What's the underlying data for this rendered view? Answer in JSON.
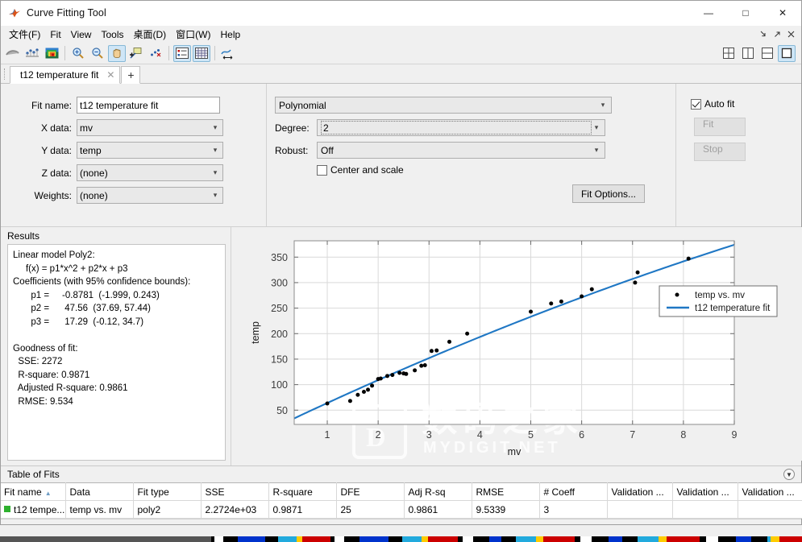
{
  "window": {
    "title": "Curve Fitting Tool",
    "minimize": "—",
    "maximize": "□",
    "close": "✕"
  },
  "menu": {
    "items": [
      {
        "label": "文件(F)",
        "name": "menu-file"
      },
      {
        "label": "Fit",
        "name": "menu-fit"
      },
      {
        "label": "View",
        "name": "menu-view"
      },
      {
        "label": "Tools",
        "name": "menu-tools"
      },
      {
        "label": "桌面(D)",
        "name": "menu-desktop"
      },
      {
        "label": "窗口(W)",
        "name": "menu-window"
      },
      {
        "label": "Help",
        "name": "menu-help"
      }
    ],
    "right_icons": [
      "dock-icon",
      "undock-icon",
      "close-icon"
    ]
  },
  "toolbar": {
    "buttons": [
      "fit-curve-icon",
      "data-points-icon",
      "surface-plot-icon",
      "zoom-in-icon",
      "zoom-out-icon",
      "pan-icon",
      "data-cursor-icon",
      "exclude-outliers-icon",
      "legend-icon",
      "grid-icon",
      "axes-limits-icon"
    ],
    "layout_buttons": [
      "layout-quad-icon",
      "layout-vertical-icon",
      "layout-horizontal-icon",
      "layout-single-icon"
    ]
  },
  "tabs": {
    "active": "t12 temperature fit",
    "close_glyph": "✕",
    "add_glyph": "+"
  },
  "fit_setup": {
    "fit_name_label": "Fit name:",
    "fit_name_value": "t12 temperature fit",
    "fields": [
      {
        "label": "X data:",
        "value": "mv",
        "name": "x-data-select"
      },
      {
        "label": "Y data:",
        "value": "temp",
        "name": "y-data-select"
      },
      {
        "label": "Z data:",
        "value": "(none)",
        "name": "z-data-select"
      },
      {
        "label": "Weights:",
        "value": "(none)",
        "name": "weights-select"
      }
    ]
  },
  "fit_type": {
    "model": "Polynomial",
    "degree_label": "Degree:",
    "degree_value": "2",
    "robust_label": "Robust:",
    "robust_value": "Off",
    "center_and_scale": "Center and scale",
    "center_and_scale_checked": false,
    "fit_options_button": "Fit Options..."
  },
  "fit_controls": {
    "auto_fit_label": "Auto fit",
    "auto_fit_checked": true,
    "fit_button": "Fit",
    "stop_button": "Stop"
  },
  "results": {
    "title": "Results",
    "text": "Linear model Poly2:\n     f(x) = p1*x^2 + p2*x + p3\nCoefficients (with 95% confidence bounds):\n       p1 =     -0.8781  (-1.999, 0.243)\n       p2 =      47.56  (37.69, 57.44)\n       p3 =      17.29  (-0.12, 34.7)\n\nGoodness of fit:\n  SSE: 2272\n  R-square: 0.9871\n  Adjusted R-square: 0.9861\n  RMSE: 9.534"
  },
  "chart_data": {
    "type": "scatter",
    "title": "",
    "xlabel": "mv",
    "ylabel": "temp",
    "xlim": [
      0.35,
      9.0
    ],
    "ylim": [
      22,
      382
    ],
    "xticks": [
      1,
      2,
      3,
      4,
      5,
      6,
      7,
      8,
      9
    ],
    "yticks": [
      50,
      100,
      150,
      200,
      250,
      300,
      350
    ],
    "grid": true,
    "legend_position": "right",
    "series": [
      {
        "name": "temp vs. mv",
        "type": "scatter",
        "marker": "dot",
        "color": "#000000",
        "points": [
          [
            1.0,
            63
          ],
          [
            1.45,
            68
          ],
          [
            1.6,
            80
          ],
          [
            1.72,
            86
          ],
          [
            1.8,
            90
          ],
          [
            1.88,
            98
          ],
          [
            2.0,
            111
          ],
          [
            2.05,
            112
          ],
          [
            2.18,
            117
          ],
          [
            2.28,
            119
          ],
          [
            2.42,
            123
          ],
          [
            2.5,
            122
          ],
          [
            2.55,
            121
          ],
          [
            2.72,
            128
          ],
          [
            2.85,
            137
          ],
          [
            2.92,
            138
          ],
          [
            3.05,
            166
          ],
          [
            3.15,
            167
          ],
          [
            3.4,
            184
          ],
          [
            3.75,
            200
          ],
          [
            5.0,
            243
          ],
          [
            5.4,
            259
          ],
          [
            5.6,
            263
          ],
          [
            6.0,
            273
          ],
          [
            6.2,
            287
          ],
          [
            7.05,
            300
          ],
          [
            7.1,
            320
          ],
          [
            8.1,
            347
          ]
        ]
      },
      {
        "name": "t12 temperature fit",
        "type": "line",
        "color": "#1f77c4",
        "equation": "f(x) = -0.8781*x^2 + 47.56*x + 17.29"
      }
    ],
    "legend": [
      {
        "label": "temp vs. mv",
        "marker": "dot",
        "color": "#000000"
      },
      {
        "label": "t12 temperature fit",
        "marker": "line",
        "color": "#1f77c4"
      }
    ]
  },
  "table_of_fits": {
    "title": "Table of Fits",
    "columns": [
      "Fit name",
      "Data",
      "Fit type",
      "SSE",
      "R-square",
      "DFE",
      "Adj R-sq",
      "RMSE",
      "# Coeff",
      "Validation ...",
      "Validation ...",
      "Validation ..."
    ],
    "sorted_column": "Fit name",
    "sort_caret": "▲",
    "rows": [
      {
        "fit_name": "t12 tempe...",
        "data": "temp vs. mv",
        "fit_type": "poly2",
        "sse": "2.2724e+03",
        "r_square": "0.9871",
        "dfe": "25",
        "adj_r_sq": "0.9861",
        "rmse": "9.5339",
        "num_coeff": "3",
        "validation_1": "",
        "validation_2": "",
        "validation_3": ""
      }
    ],
    "collapse_glyph": "▼"
  },
  "watermark": {
    "text_cn": "数码之家",
    "text_en": "MYDIGIT.NET"
  },
  "colors": {
    "fit_line": "#1f77c4",
    "accent": "#cfe6f7",
    "swatch_green": "#2fb12f"
  }
}
